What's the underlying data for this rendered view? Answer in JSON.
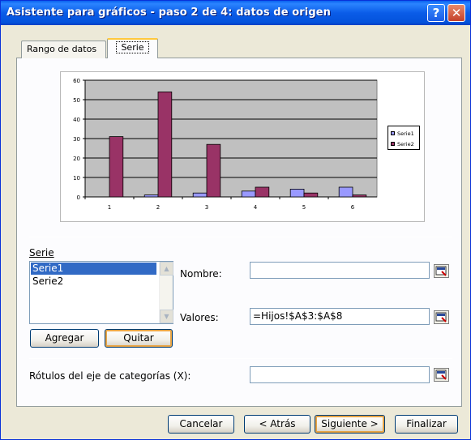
{
  "window": {
    "title": "Asistente para gráficos - paso 2 de 4: datos de origen",
    "help_glyph": "?",
    "close_glyph": "✕"
  },
  "tabs": [
    {
      "label": "Rango de datos",
      "selected": false
    },
    {
      "label": "Serie",
      "selected": true
    }
  ],
  "chart_data": {
    "type": "bar",
    "categories": [
      "1",
      "2",
      "3",
      "4",
      "5",
      "6"
    ],
    "series": [
      {
        "name": "Serie1",
        "color": "#9999ff",
        "values": [
          0,
          1,
          2,
          3,
          4,
          5
        ]
      },
      {
        "name": "Serie2",
        "color": "#993366",
        "values": [
          31,
          54,
          27,
          5,
          2,
          1
        ]
      }
    ],
    "ylim": [
      0,
      60
    ],
    "yticks": [
      "0",
      "10",
      "20",
      "30",
      "40",
      "50",
      "60"
    ],
    "plot_background": "#c0c0c0",
    "grid": true,
    "legend_position": "right"
  },
  "serie_section": {
    "label": "Serie",
    "items": [
      "Serie1",
      "Serie2"
    ],
    "selected_index": 0,
    "add_button": "Agregar",
    "remove_button": "Quitar"
  },
  "fields": {
    "name_label": "Nombre:",
    "name_value": "",
    "values_label": "Valores:",
    "values_value": "=Hijos!$A$3:$A$8",
    "category_label": "Rótulos del eje de categorías (X):",
    "category_value": ""
  },
  "footer": {
    "cancel": "Cancelar",
    "back": "< Atrás",
    "next": "Siguiente >",
    "finish": "Finalizar"
  }
}
